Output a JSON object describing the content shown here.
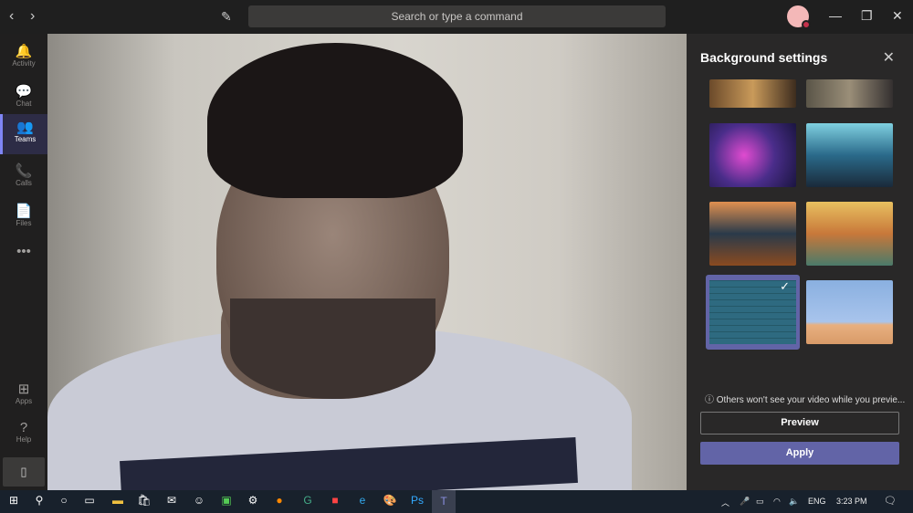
{
  "titlebar": {
    "search_placeholder": "Search or type a command",
    "back": "‹",
    "forward": "›",
    "minimize": "—",
    "maximize": "❐",
    "close": "✕"
  },
  "rail": {
    "items": [
      {
        "label": "Activity",
        "icon": "🔔"
      },
      {
        "label": "Chat",
        "icon": "💬"
      },
      {
        "label": "Teams",
        "icon": "👥"
      },
      {
        "label": "Calls",
        "icon": "📞"
      },
      {
        "label": "Files",
        "icon": "📄"
      },
      {
        "label": "",
        "icon": "•••"
      },
      {
        "label": "Apps",
        "icon": "⊞"
      },
      {
        "label": "Help",
        "icon": "?"
      }
    ]
  },
  "panel": {
    "title": "Background settings",
    "info": "Others won't see your video while you previe...",
    "preview_label": "Preview",
    "apply_label": "Apply",
    "selected_index": 6
  },
  "taskbar": {
    "language": "ENG",
    "time": "3:23 PM"
  },
  "colors": {
    "accent": "#6264a7",
    "panel_bg": "#292828",
    "rail_bg": "#201f1f"
  }
}
